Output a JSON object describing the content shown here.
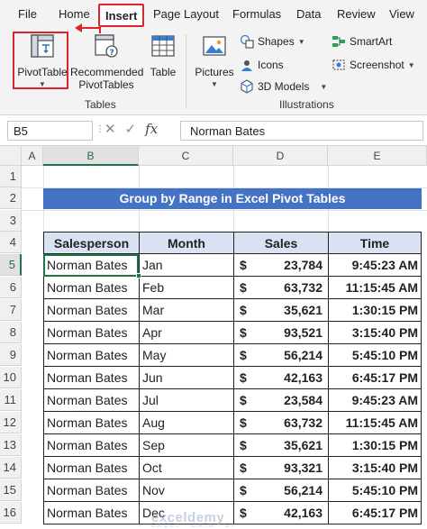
{
  "ribbon_tabs": [
    "File",
    "Home",
    "Insert",
    "Page Layout",
    "Formulas",
    "Data",
    "Review",
    "View"
  ],
  "active_tab": "Insert",
  "tables_group": {
    "label": "Tables",
    "pivottable": "PivotTable",
    "recommended_line1": "Recommended",
    "recommended_line2": "PivotTables",
    "table": "Table"
  },
  "illustrations_group": {
    "label": "Illustrations",
    "pictures": "Pictures",
    "shapes": "Shapes",
    "icons": "Icons",
    "models3d": "3D Models",
    "smartart": "SmartArt",
    "screenshot": "Screenshot"
  },
  "formula_bar": {
    "name_box": "B5",
    "fx": "fx",
    "value": "Norman Bates"
  },
  "columns": [
    "A",
    "B",
    "C",
    "D",
    "E"
  ],
  "selected_column": "B",
  "rows": [
    "1",
    "2",
    "3",
    "4",
    "5",
    "6",
    "7",
    "8",
    "9",
    "10",
    "11",
    "12",
    "13",
    "14",
    "15",
    "16"
  ],
  "selected_row": "5",
  "sheet": {
    "title": "Group by Range in Excel Pivot Tables",
    "headers": [
      "Salesperson",
      "Month",
      "Sales",
      "Time"
    ],
    "currency": "$",
    "records": [
      {
        "name": "Norman Bates",
        "month": "Jan",
        "sales": "23,784",
        "time": "9:45:23 AM"
      },
      {
        "name": "Norman Bates",
        "month": "Feb",
        "sales": "63,732",
        "time": "11:15:45 AM"
      },
      {
        "name": "Norman Bates",
        "month": "Mar",
        "sales": "35,621",
        "time": "1:30:15 PM"
      },
      {
        "name": "Norman Bates",
        "month": "Apr",
        "sales": "93,521",
        "time": "3:15:40 PM"
      },
      {
        "name": "Norman Bates",
        "month": "May",
        "sales": "56,214",
        "time": "5:45:10 PM"
      },
      {
        "name": "Norman Bates",
        "month": "Jun",
        "sales": "42,163",
        "time": "6:45:17 PM"
      },
      {
        "name": "Norman Bates",
        "month": "Jul",
        "sales": "23,584",
        "time": "9:45:23 AM"
      },
      {
        "name": "Norman Bates",
        "month": "Aug",
        "sales": "63,732",
        "time": "11:15:45 AM"
      },
      {
        "name": "Norman Bates",
        "month": "Sep",
        "sales": "35,621",
        "time": "1:30:15 PM"
      },
      {
        "name": "Norman Bates",
        "month": "Oct",
        "sales": "93,321",
        "time": "3:15:40 PM"
      },
      {
        "name": "Norman Bates",
        "month": "Nov",
        "sales": "56,214",
        "time": "5:45:10 PM"
      },
      {
        "name": "Norman Bates",
        "month": "Dec",
        "sales": "42,163",
        "time": "6:45:17 PM"
      }
    ]
  },
  "watermark": {
    "brand": "exceldemy",
    "tagline": "EXCEL · DATA · BI"
  },
  "colors": {
    "title_fill": "#4472c4",
    "header_fill": "#d9e2f3",
    "highlight": "#d9262a",
    "excel_green": "#217346"
  }
}
